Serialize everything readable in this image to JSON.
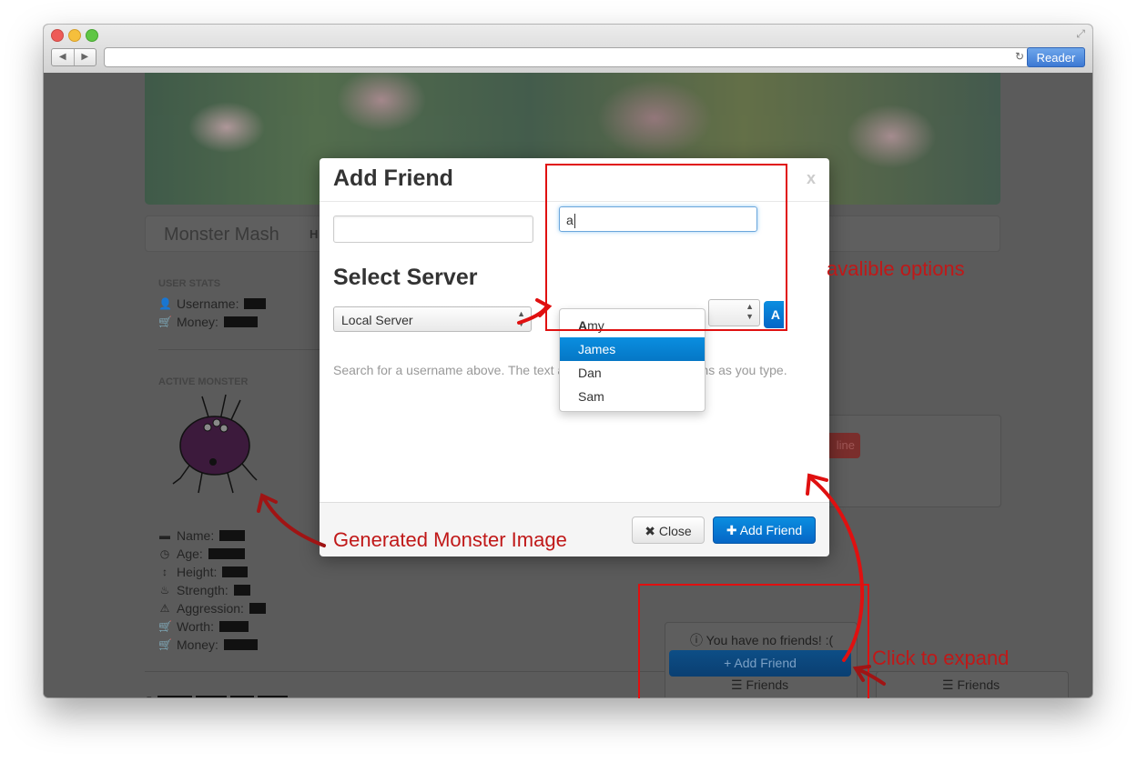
{
  "browser": {
    "reader_label": "Reader",
    "back_icon": "◀",
    "forward_icon": "▶",
    "reload_icon": "↻"
  },
  "site": {
    "brand": "Monster Mash",
    "nav_partial": "H",
    "user_stats_heading": "USER STATS",
    "user_stats": [
      {
        "icon": "user-icon",
        "label": "Username:"
      },
      {
        "icon": "cart-icon",
        "label": "Money:"
      }
    ],
    "active_monster_heading": "ACTIVE MONSTER",
    "monster_stats": [
      {
        "icon": "comment-icon",
        "label": "Name:"
      },
      {
        "icon": "clock-icon",
        "label": "Age:"
      },
      {
        "icon": "resize-icon",
        "label": "Height:"
      },
      {
        "icon": "fire-icon",
        "label": "Strength:"
      },
      {
        "icon": "warning-icon",
        "label": "Aggression:"
      },
      {
        "icon": "cart-icon",
        "label": "Worth:"
      },
      {
        "icon": "cart-icon",
        "label": "Money:"
      }
    ],
    "footer_copyright": "©",
    "bg_red_button_partial": "line",
    "no_friends_text": "You have no friends! :(",
    "bg_add_friend_label": "Add Friend",
    "friends_tab_1": "Friends",
    "friends_tab_2": "Friends"
  },
  "modal": {
    "title": "Add Friend",
    "close_x": "x",
    "search_value": "a",
    "select_server_title": "Select Server",
    "server_selected": "Local Server",
    "add_partial": "A",
    "hint": "Search for a username above. The text area should list suggestions as you type.",
    "close_button": "Close",
    "add_friend_button": "Add Friend",
    "suggestions": [
      {
        "match": "A",
        "rest": "my",
        "active": false
      },
      {
        "match": "",
        "rest": "James",
        "active": true
      },
      {
        "match": "",
        "rest": "Dan",
        "active": false
      },
      {
        "match": "",
        "rest": "Sam",
        "active": false
      }
    ]
  },
  "annotations": {
    "options": "avalible options",
    "monster_image": "Generated Monster Image",
    "expand": "Click to expand"
  }
}
